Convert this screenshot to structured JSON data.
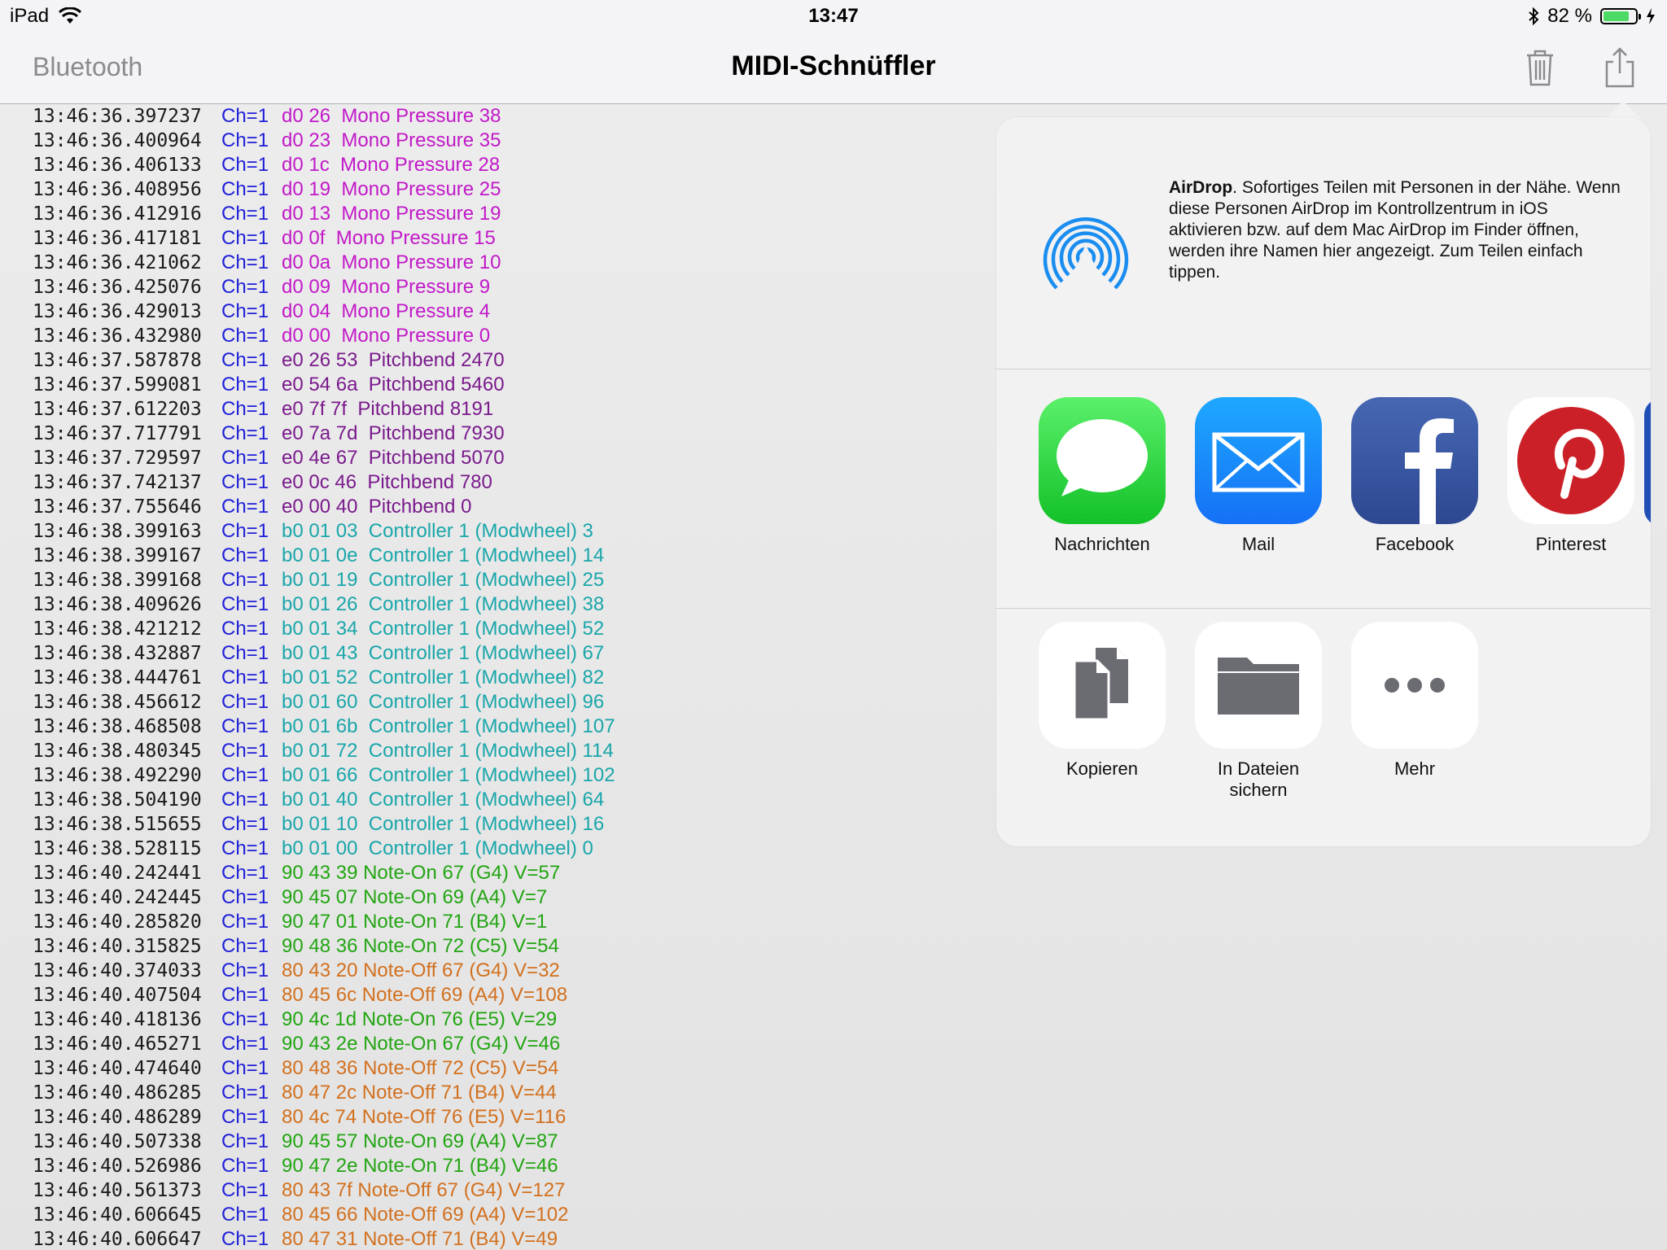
{
  "status": {
    "device": "iPad",
    "time": "13:47",
    "battery_percent": "82 %",
    "battery_level": 0.82
  },
  "nav": {
    "back_label": "Bluetooth",
    "title": "MIDI-Schnüffler"
  },
  "colors": {
    "channel": "#1f1fd8",
    "mono_pressure": "#c219c8",
    "pitchbend": "#7a1a8c",
    "controller": "#1aa6aa",
    "note_on": "#22a512",
    "note_off": "#d2701e",
    "airdrop": "#1a8df0"
  },
  "log": [
    {
      "ts": "13:46:36.397237",
      "ch": "Ch=1",
      "msg": "d0 26  Mono Pressure 38",
      "kind": "press"
    },
    {
      "ts": "13:46:36.400964",
      "ch": "Ch=1",
      "msg": "d0 23  Mono Pressure 35",
      "kind": "press"
    },
    {
      "ts": "13:46:36.406133",
      "ch": "Ch=1",
      "msg": "d0 1c  Mono Pressure 28",
      "kind": "press"
    },
    {
      "ts": "13:46:36.408956",
      "ch": "Ch=1",
      "msg": "d0 19  Mono Pressure 25",
      "kind": "press"
    },
    {
      "ts": "13:46:36.412916",
      "ch": "Ch=1",
      "msg": "d0 13  Mono Pressure 19",
      "kind": "press"
    },
    {
      "ts": "13:46:36.417181",
      "ch": "Ch=1",
      "msg": "d0 0f  Mono Pressure 15",
      "kind": "press"
    },
    {
      "ts": "13:46:36.421062",
      "ch": "Ch=1",
      "msg": "d0 0a  Mono Pressure 10",
      "kind": "press"
    },
    {
      "ts": "13:46:36.425076",
      "ch": "Ch=1",
      "msg": "d0 09  Mono Pressure 9",
      "kind": "press"
    },
    {
      "ts": "13:46:36.429013",
      "ch": "Ch=1",
      "msg": "d0 04  Mono Pressure 4",
      "kind": "press"
    },
    {
      "ts": "13:46:36.432980",
      "ch": "Ch=1",
      "msg": "d0 00  Mono Pressure 0",
      "kind": "press"
    },
    {
      "ts": "13:46:37.587878",
      "ch": "Ch=1",
      "msg": "e0 26 53  Pitchbend 2470",
      "kind": "pitch"
    },
    {
      "ts": "13:46:37.599081",
      "ch": "Ch=1",
      "msg": "e0 54 6a  Pitchbend 5460",
      "kind": "pitch"
    },
    {
      "ts": "13:46:37.612203",
      "ch": "Ch=1",
      "msg": "e0 7f 7f  Pitchbend 8191",
      "kind": "pitch"
    },
    {
      "ts": "13:46:37.717791",
      "ch": "Ch=1",
      "msg": "e0 7a 7d  Pitchbend 7930",
      "kind": "pitch"
    },
    {
      "ts": "13:46:37.729597",
      "ch": "Ch=1",
      "msg": "e0 4e 67  Pitchbend 5070",
      "kind": "pitch"
    },
    {
      "ts": "13:46:37.742137",
      "ch": "Ch=1",
      "msg": "e0 0c 46  Pitchbend 780",
      "kind": "pitch"
    },
    {
      "ts": "13:46:37.755646",
      "ch": "Ch=1",
      "msg": "e0 00 40  Pitchbend 0",
      "kind": "pitch"
    },
    {
      "ts": "13:46:38.399163",
      "ch": "Ch=1",
      "msg": "b0 01 03  Controller 1 (Modwheel) 3",
      "kind": "ctrl"
    },
    {
      "ts": "13:46:38.399167",
      "ch": "Ch=1",
      "msg": "b0 01 0e  Controller 1 (Modwheel) 14",
      "kind": "ctrl"
    },
    {
      "ts": "13:46:38.399168",
      "ch": "Ch=1",
      "msg": "b0 01 19  Controller 1 (Modwheel) 25",
      "kind": "ctrl"
    },
    {
      "ts": "13:46:38.409626",
      "ch": "Ch=1",
      "msg": "b0 01 26  Controller 1 (Modwheel) 38",
      "kind": "ctrl"
    },
    {
      "ts": "13:46:38.421212",
      "ch": "Ch=1",
      "msg": "b0 01 34  Controller 1 (Modwheel) 52",
      "kind": "ctrl"
    },
    {
      "ts": "13:46:38.432887",
      "ch": "Ch=1",
      "msg": "b0 01 43  Controller 1 (Modwheel) 67",
      "kind": "ctrl"
    },
    {
      "ts": "13:46:38.444761",
      "ch": "Ch=1",
      "msg": "b0 01 52  Controller 1 (Modwheel) 82",
      "kind": "ctrl"
    },
    {
      "ts": "13:46:38.456612",
      "ch": "Ch=1",
      "msg": "b0 01 60  Controller 1 (Modwheel) 96",
      "kind": "ctrl"
    },
    {
      "ts": "13:46:38.468508",
      "ch": "Ch=1",
      "msg": "b0 01 6b  Controller 1 (Modwheel) 107",
      "kind": "ctrl"
    },
    {
      "ts": "13:46:38.480345",
      "ch": "Ch=1",
      "msg": "b0 01 72  Controller 1 (Modwheel) 114",
      "kind": "ctrl"
    },
    {
      "ts": "13:46:38.492290",
      "ch": "Ch=1",
      "msg": "b0 01 66  Controller 1 (Modwheel) 102",
      "kind": "ctrl"
    },
    {
      "ts": "13:46:38.504190",
      "ch": "Ch=1",
      "msg": "b0 01 40  Controller 1 (Modwheel) 64",
      "kind": "ctrl"
    },
    {
      "ts": "13:46:38.515655",
      "ch": "Ch=1",
      "msg": "b0 01 10  Controller 1 (Modwheel) 16",
      "kind": "ctrl"
    },
    {
      "ts": "13:46:38.528115",
      "ch": "Ch=1",
      "msg": "b0 01 00  Controller 1 (Modwheel) 0",
      "kind": "ctrl"
    },
    {
      "ts": "13:46:40.242441",
      "ch": "Ch=1",
      "msg": "90 43 39 Note-On 67 (G4) V=57",
      "kind": "on"
    },
    {
      "ts": "13:46:40.242445",
      "ch": "Ch=1",
      "msg": "90 45 07 Note-On 69 (A4) V=7",
      "kind": "on"
    },
    {
      "ts": "13:46:40.285820",
      "ch": "Ch=1",
      "msg": "90 47 01 Note-On 71 (B4) V=1",
      "kind": "on"
    },
    {
      "ts": "13:46:40.315825",
      "ch": "Ch=1",
      "msg": "90 48 36 Note-On 72 (C5) V=54",
      "kind": "on"
    },
    {
      "ts": "13:46:40.374033",
      "ch": "Ch=1",
      "msg": "80 43 20 Note-Off 67 (G4) V=32",
      "kind": "off"
    },
    {
      "ts": "13:46:40.407504",
      "ch": "Ch=1",
      "msg": "80 45 6c Note-Off 69 (A4) V=108",
      "kind": "off"
    },
    {
      "ts": "13:46:40.418136",
      "ch": "Ch=1",
      "msg": "90 4c 1d Note-On 76 (E5) V=29",
      "kind": "on"
    },
    {
      "ts": "13:46:40.465271",
      "ch": "Ch=1",
      "msg": "90 43 2e Note-On 67 (G4) V=46",
      "kind": "on"
    },
    {
      "ts": "13:46:40.474640",
      "ch": "Ch=1",
      "msg": "80 48 36 Note-Off 72 (C5) V=54",
      "kind": "off"
    },
    {
      "ts": "13:46:40.486285",
      "ch": "Ch=1",
      "msg": "80 47 2c Note-Off 71 (B4) V=44",
      "kind": "off"
    },
    {
      "ts": "13:46:40.486289",
      "ch": "Ch=1",
      "msg": "80 4c 74 Note-Off 76 (E5) V=116",
      "kind": "off"
    },
    {
      "ts": "13:46:40.507338",
      "ch": "Ch=1",
      "msg": "90 45 57 Note-On 69 (A4) V=87",
      "kind": "on"
    },
    {
      "ts": "13:46:40.526986",
      "ch": "Ch=1",
      "msg": "90 47 2e Note-On 71 (B4) V=46",
      "kind": "on"
    },
    {
      "ts": "13:46:40.561373",
      "ch": "Ch=1",
      "msg": "80 43 7f Note-Off 67 (G4) V=127",
      "kind": "off"
    },
    {
      "ts": "13:46:40.606645",
      "ch": "Ch=1",
      "msg": "80 45 66 Note-Off 69 (A4) V=102",
      "kind": "off"
    },
    {
      "ts": "13:46:40.606647",
      "ch": "Ch=1",
      "msg": "80 47 31 Note-Off 71 (B4) V=49",
      "kind": "off"
    }
  ],
  "share": {
    "airdrop_title": "AirDrop",
    "airdrop_body": ". Sofortiges Teilen mit Personen in der Nähe. Wenn diese Personen AirDrop im Kontrollzentrum in iOS aktivieren bzw. auf dem Mac AirDrop im Finder öffnen, werden ihre Namen hier angezeigt. Zum Teilen einfach tippen.",
    "apps": [
      {
        "label": "Nachrichten",
        "icon": "messages-icon"
      },
      {
        "label": "Mail",
        "icon": "mail-icon"
      },
      {
        "label": "Facebook",
        "icon": "facebook-icon"
      },
      {
        "label": "Pinterest",
        "icon": "pinterest-icon"
      }
    ],
    "actions": [
      {
        "label": "Kopieren",
        "icon": "copy-icon"
      },
      {
        "label": "In Dateien sichern",
        "icon": "folder-icon"
      },
      {
        "label": "Mehr",
        "icon": "more-icon"
      }
    ]
  }
}
